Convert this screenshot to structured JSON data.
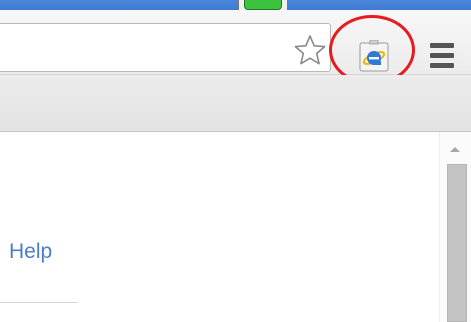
{
  "toolbar": {
    "bookmark_star_icon": "star-icon",
    "extension_icon": "internet-explorer-icon",
    "menu_icon": "hamburger-menu-icon"
  },
  "content": {
    "help_link": "Help"
  },
  "colors": {
    "title_bar": "#3f7bd2",
    "highlight": "#e8191f",
    "link": "#4a7ec9"
  }
}
